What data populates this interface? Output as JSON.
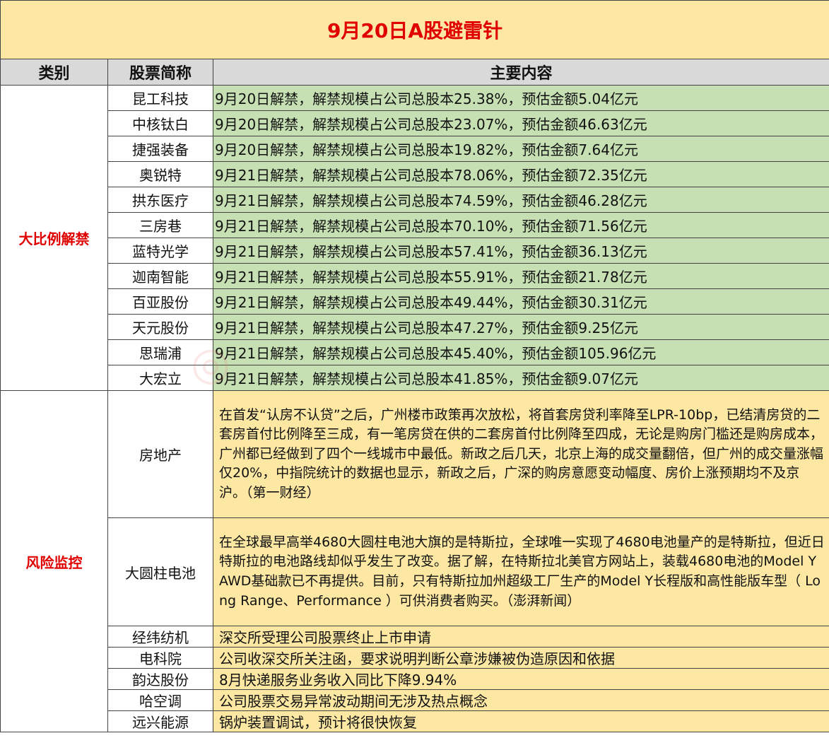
{
  "title": "9月20日A股避雷针",
  "headers": [
    "类别",
    "股票简称",
    "主要内容"
  ],
  "sections": [
    {
      "category": "大比例解禁",
      "rows": [
        {
          "name": "昆工科技",
          "content": "9月20日解禁，解禁规模占公司总股本25.38%，预估金额5.04亿元"
        },
        {
          "name": "中核钛白",
          "content": "9月20日解禁，解禁规模占公司总股本23.07%，预估金额46.63亿元"
        },
        {
          "name": "捷强装备",
          "content": "9月20日解禁，解禁规模占公司总股本19.82%，预估金额7.64亿元"
        },
        {
          "name": "奥锐特",
          "content": "9月21日解禁，解禁规模占公司总股本78.06%，预估金额72.35亿元"
        },
        {
          "name": "拱东医疗",
          "content": "9月21日解禁，解禁规模占公司总股本74.59%，预估金额46.28亿元"
        },
        {
          "name": "三房巷",
          "content": "9月21日解禁，解禁规模占公司总股本70.10%，预估金额71.56亿元"
        },
        {
          "name": "蓝特光学",
          "content": "9月21日解禁，解禁规模占公司总股本57.41%，预估金额36.13亿元"
        },
        {
          "name": "迦南智能",
          "content": "9月21日解禁，解禁规模占公司总股本55.91%，预估金额21.78亿元"
        },
        {
          "name": "百亚股份",
          "content": "9月21日解禁，解禁规模占公司总股本49.44%，预估金额30.31亿元"
        },
        {
          "name": "天元股份",
          "content": "9月21日解禁，解禁规模占公司总股本47.27%，预估金额9.25亿元"
        },
        {
          "name": "思瑞浦",
          "content": "9月21日解禁，解禁规模占公司总股本45.40%，预估金额105.96亿元"
        },
        {
          "name": "大宏立",
          "content": "9月21日解禁，解禁规模占公司总股本41.85%，预估金额9.07亿元"
        }
      ]
    },
    {
      "category": "风险监控",
      "rows": [
        {
          "name": "房地产",
          "content": "在首发“认房不认贷”之后，广州楼市政策再次放松，将首套房贷利率降至LPR-10bp，已结清房贷的二套房首付比例降至三成，有一笔房贷在供的二套房首付比例降至四成，无论是购房门槛还是购房成本，广州都已经做到了四个一线城市中最低。新政之后几天，北京上海的成交量翻倍，但广州的成交量涨幅仅20%，中指院统计的数据也显示，新政之后，广深的购房意愿变动幅度、房价上涨预期均不及京沪。（第一财经）"
        },
        {
          "name": "大圆柱电池",
          "content": "在全球最早高举4680大圆柱电池大旗的是特斯拉，全球唯一实现了4680电池量产的是特斯拉，但近日特斯拉的电池路线却似乎发生了改变。据了解，在特斯拉北美官方网站上，装载4680电池的Model Y AWD基础款已不再提供。目前，只有特斯拉加州超级工厂生产的Model Y长程版和高性能版车型（ Long Range、Performance ）可供消费者购买。（澎湃新闻）"
        },
        {
          "name": "经纬纺机",
          "content": "深交所受理公司股票终止上市申请"
        },
        {
          "name": "电科院",
          "content": "公司收深交所关注函，要求说明判断公章涉嫌被伪造原因和依据"
        },
        {
          "name": "韵达股份",
          "content": "8月快递服务业务收入同比下降9.94%"
        },
        {
          "name": "哈空调",
          "content": "公司股票交易异常波动期间无涉及热点概念"
        },
        {
          "name": "远兴能源",
          "content": "锅炉装置调试，预计将很快恢复"
        }
      ]
    }
  ],
  "colors": {
    "title_bg": "#fde8a3",
    "title_text": "#e00000",
    "header_bg": "#d9d9d9",
    "unlock_bg": "#c6e0b4",
    "risk_bg": "#fde8a3",
    "category_text": "#e00000"
  }
}
